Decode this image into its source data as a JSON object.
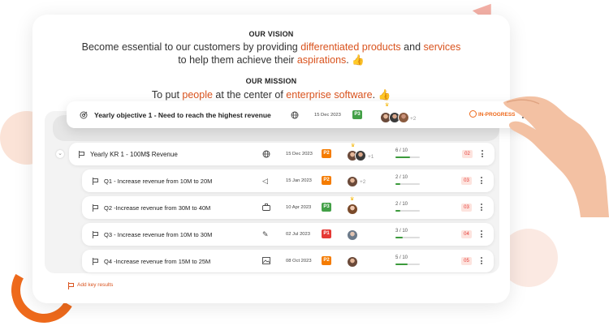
{
  "vision": {
    "title": "OUR VISION",
    "line1_a": "Become essential to our customers by providing ",
    "line1_b": "differentiated products",
    "line1_c": " and ",
    "line1_d": "services",
    "line2_a": "to help them achieve their ",
    "line2_b": "aspirations",
    "line2_c": ". 👍"
  },
  "mission": {
    "title": "OUR MISSION",
    "text_a": "To put ",
    "text_b": "people",
    "text_c": " at the center of ",
    "text_d": "enterprise software",
    "text_e": ". 👍"
  },
  "objective": {
    "title": "Yearly objective 1 - Need to reach the highest revenue",
    "date": "15 Dec 2023",
    "priority": "P3",
    "more_avatars": "+2",
    "status": "IN-PROGRESS"
  },
  "key_results": [
    {
      "title": "Yearly KR 1 - 100M$ Revenue",
      "icon": "globe-icon",
      "date": "15 Dec 2023",
      "priority": "P2",
      "more": "+1",
      "progress_text": "6 / 10",
      "progress": 0.6,
      "count": "02"
    },
    {
      "title": "Q1 - Increase revenue from 10M to 20M",
      "icon": "megaphone-icon",
      "date": "15 Jan 2023",
      "priority": "P2",
      "more": "+2",
      "progress_text": "2 / 10",
      "progress": 0.2,
      "count": "03"
    },
    {
      "title": "Q2 -Increase revenue from 30M to 40M",
      "icon": "briefcase-icon",
      "date": "10 Apr 2023",
      "priority": "P3",
      "more": "",
      "progress_text": "2 / 10",
      "progress": 0.2,
      "count": "03"
    },
    {
      "title": "Q3 - Increase revenue from 10M to 30M",
      "icon": "pencil-icon",
      "date": "02 Jul 2023",
      "priority": "P1",
      "more": "",
      "progress_text": "3 / 10",
      "progress": 0.3,
      "count": "04"
    },
    {
      "title": "Q4 -Increase revenue from 15M to 25M",
      "icon": "image-icon",
      "date": "08 Oct 2023",
      "priority": "P2",
      "more": "",
      "progress_text": "5 / 10",
      "progress": 0.5,
      "count": "05"
    }
  ],
  "add_key_results": "Add key results",
  "colors": {
    "accent": "#d9531e",
    "p1": "#e53935",
    "p2": "#f57c00",
    "p3": "#43a047",
    "progress": "#3b9a3b"
  }
}
